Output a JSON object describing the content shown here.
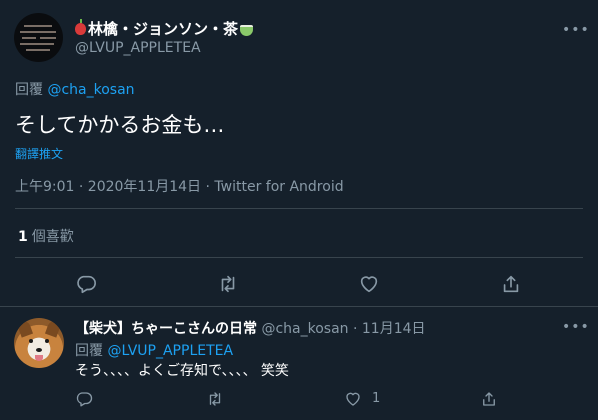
{
  "main_tweet": {
    "display_name": "林檎・ジョンソン・茶",
    "name_emoji_prefix": "red-apple-emoji",
    "name_emoji_suffix": "matcha-tea-emoji",
    "handle": "@LVUP_APPLETEA",
    "more": "•••",
    "reply_to_label": "回覆",
    "reply_to_handle": "@cha_kosan",
    "text": "そしてかかるお金も…",
    "translate_label": "翻譯推文",
    "meta": "上午9:01 · 2020年11月14日 · Twitter for Android",
    "likes_count": "1",
    "likes_label": "個喜歡",
    "actions": [
      "reply-icon",
      "retweet-icon",
      "like-icon",
      "share-icon"
    ]
  },
  "reply_tweet": {
    "display_name": "【柴犬】ちゃーこさんの日常",
    "handle": "@cha_kosan",
    "separator": "·",
    "date": "11月14日",
    "more": "•••",
    "reply_to_label": "回覆",
    "reply_to_handle": "@LVUP_APPLETEA",
    "text": "そう、、、、よくご存知で、、、、 笑笑",
    "like_count": "1",
    "actions": [
      "reply-icon",
      "retweet-icon",
      "like-icon",
      "share-icon"
    ]
  },
  "colors": {
    "background": "#15202b",
    "text_primary": "#ffffff",
    "text_secondary": "#8899a6",
    "link": "#1da1f2",
    "divider": "#38444d"
  }
}
